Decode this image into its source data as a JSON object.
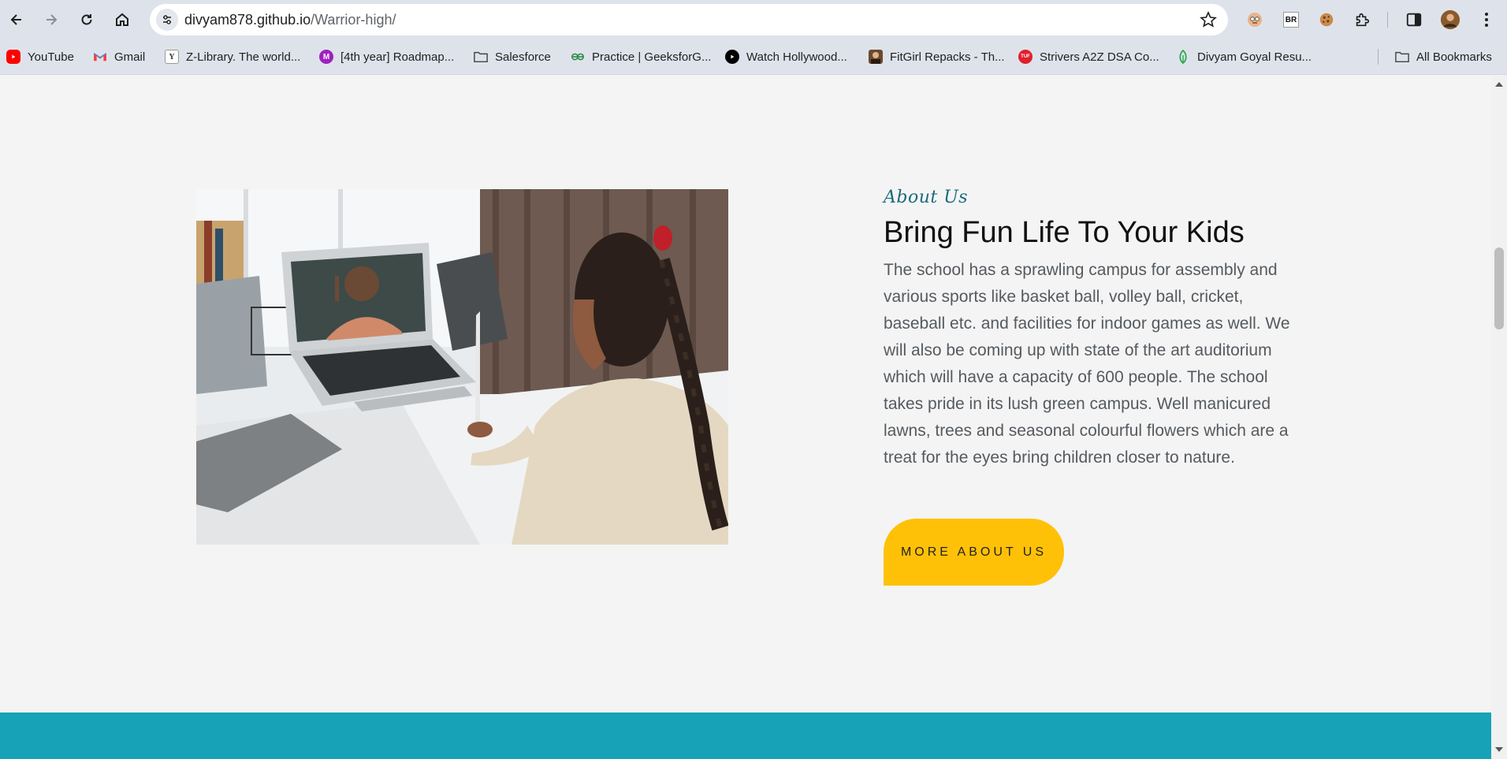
{
  "browser": {
    "url_host": "divyam878.github.io",
    "url_path": "/Warrior-high/",
    "bookmarks": [
      {
        "label": "YouTube",
        "icon": "youtube-icon"
      },
      {
        "label": "Gmail",
        "icon": "gmail-icon"
      },
      {
        "label": "Z-Library. The world...",
        "icon": "zlibrary-icon"
      },
      {
        "label": "[4th year] Roadmap...",
        "icon": "m-icon"
      },
      {
        "label": "Salesforce",
        "icon": "folder-icon"
      },
      {
        "label": "Practice | GeeksforG...",
        "icon": "geeksforgeeks-icon"
      },
      {
        "label": "Watch Hollywood...",
        "icon": "play-icon"
      },
      {
        "label": "FitGirl Repacks - Th...",
        "icon": "fitgirl-icon"
      },
      {
        "label": "Strivers A2Z DSA Co...",
        "icon": "tuf-icon"
      },
      {
        "label": "Divyam Goyal Resu...",
        "icon": "leaf-icon"
      }
    ],
    "all_bookmarks": "All Bookmarks",
    "extension_br": "BR"
  },
  "about": {
    "eyebrow": "About Us",
    "headline": "Bring Fun Life To Your Kids",
    "body": "The school has a sprawling campus for assembly and various sports like basket ball, volley ball, cricket, baseball etc. and facilities for indoor games as well. We will also be coming up with state of the art auditorium which will have a capacity of 600 people. The school takes pride in its lush green campus. Well manicured lawns, trees and seasonal colourful flowers which are a treat for the eyes bring children closer to nature.",
    "cta": "MORE ABOUT US"
  },
  "colors": {
    "accent": "#ffc107",
    "teal": "#17a2b8",
    "eyebrow": "#1a6b7a"
  }
}
